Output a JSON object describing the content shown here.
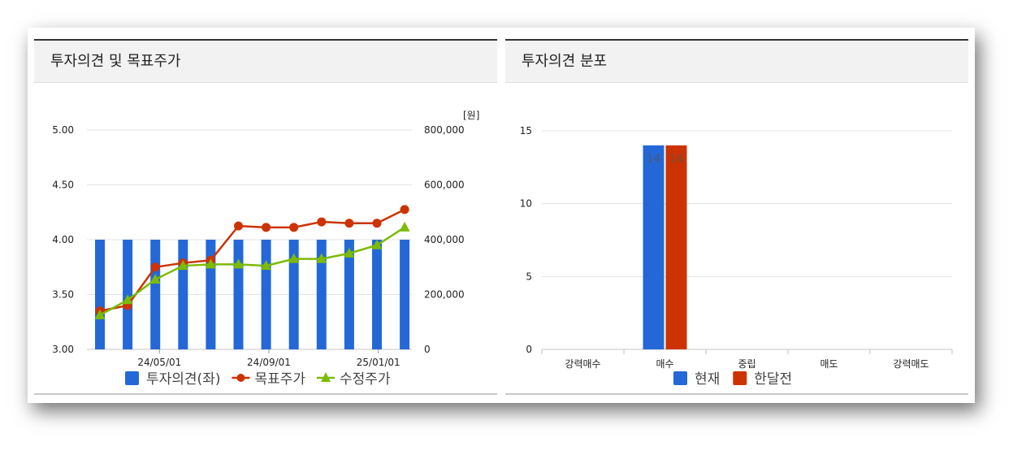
{
  "panels": {
    "left": {
      "title": "투자의견 및 목표주가"
    },
    "right": {
      "title": "투자의견 분포"
    }
  },
  "chart_data": [
    {
      "type": "bar",
      "title": "투자의견 및 목표주가",
      "y_left": {
        "ylim": [
          3.0,
          5.0
        ],
        "ticks": [
          "3.00",
          "3.50",
          "4.00",
          "4.50",
          "5.00"
        ]
      },
      "y_right": {
        "unit": "[원]",
        "ylim": [
          0,
          800000
        ],
        "ticks": [
          "0",
          "200,000",
          "400,000",
          "600,000",
          "800,000"
        ]
      },
      "x_ticks": [
        "24/05/01",
        "24/09/01",
        "25/01/01"
      ],
      "x_tick_index": [
        2.15,
        6.1,
        10.05
      ],
      "series": [
        {
          "name": "투자의견(좌)",
          "type": "bar",
          "axis": "left",
          "color": "#2468d8",
          "values": [
            4,
            4,
            4,
            4,
            4,
            4,
            4,
            4,
            4,
            4,
            4,
            4
          ]
        },
        {
          "name": "목표주가",
          "type": "line",
          "axis": "right",
          "marker": "circle",
          "color": "#cc3300",
          "values": [
            140000,
            160000,
            300000,
            315000,
            325000,
            450000,
            445000,
            445000,
            465000,
            460000,
            460000,
            510000
          ]
        },
        {
          "name": "수정주가",
          "type": "line",
          "axis": "right",
          "marker": "triangle",
          "color": "#7cbb00",
          "values": [
            125000,
            180000,
            255000,
            305000,
            310000,
            310000,
            305000,
            330000,
            330000,
            350000,
            380000,
            445000
          ]
        }
      ],
      "legend": "bottom"
    },
    {
      "type": "bar",
      "title": "투자의견 분포",
      "categories": [
        "강력매수",
        "매수",
        "중립",
        "매도",
        "강력매도"
      ],
      "ylim": [
        0,
        15
      ],
      "y_ticks": [
        "0",
        "5",
        "10",
        "15"
      ],
      "series": [
        {
          "name": "현재",
          "color": "#2468d8",
          "values": [
            0,
            14,
            0,
            0,
            0
          ]
        },
        {
          "name": "한달전",
          "color": "#cc3300",
          "values": [
            0,
            14,
            0,
            0,
            0
          ]
        }
      ],
      "data_labels": [
        "14",
        "14"
      ],
      "legend": "bottom"
    }
  ]
}
